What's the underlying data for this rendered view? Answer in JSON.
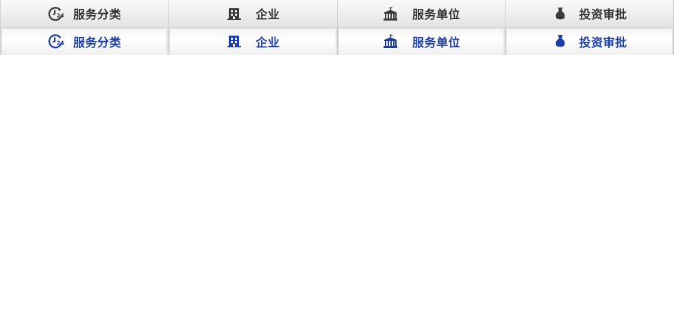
{
  "colors": {
    "normal_text": "#333333",
    "active_text": "#1e3fa8",
    "normal_icon": "#3a3a3a",
    "active_icon": "#1e3fa8"
  },
  "tabs_normal": [
    {
      "label": "服务分类",
      "icon": "clock-24-icon"
    },
    {
      "label": "企业",
      "icon": "building-icon"
    },
    {
      "label": "服务单位",
      "icon": "government-hall-icon"
    },
    {
      "label": "投资审批",
      "icon": "money-bag-icon"
    }
  ],
  "tabs_active": [
    {
      "label": "服务分类",
      "icon": "clock-24-icon"
    },
    {
      "label": "企业",
      "icon": "building-icon"
    },
    {
      "label": "服务单位",
      "icon": "government-hall-icon"
    },
    {
      "label": "投资审批",
      "icon": "money-bag-icon"
    }
  ]
}
